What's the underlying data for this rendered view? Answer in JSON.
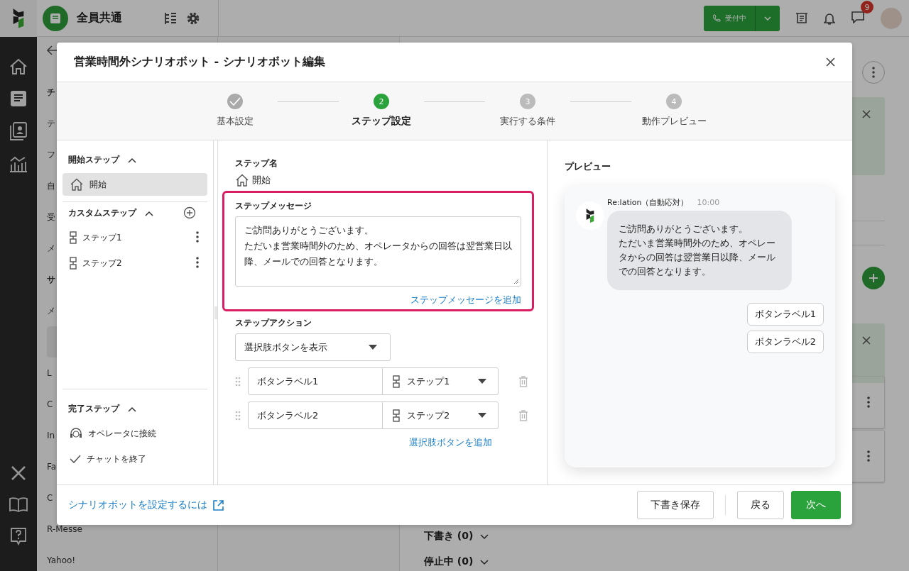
{
  "app_bar": {
    "workspace": "全員共通",
    "status_button": "受付中",
    "chat_badge": "9"
  },
  "background": {
    "list": [
      {
        "kind": "header",
        "label": "チ"
      },
      {
        "kind": "item",
        "label": "テ",
        "selected": false
      },
      {
        "kind": "item",
        "label": "フ",
        "selected": false
      },
      {
        "kind": "item",
        "label": "自",
        "selected": false
      },
      {
        "kind": "item",
        "label": "受",
        "selected": false
      },
      {
        "kind": "item",
        "label": "メ",
        "selected": false
      },
      {
        "kind": "header",
        "label": "サ"
      },
      {
        "kind": "item",
        "label": "メ",
        "selected": false
      },
      {
        "kind": "item",
        "selected": true
      },
      {
        "kind": "item",
        "label": "L",
        "selected": false
      },
      {
        "kind": "item",
        "label": "C",
        "selected": false
      },
      {
        "kind": "item",
        "label": "In",
        "selected": false
      },
      {
        "kind": "item",
        "label": "Fa",
        "selected": false
      },
      {
        "kind": "item",
        "label": "C",
        "selected": false
      },
      {
        "kind": "item",
        "label": "R-Messe",
        "selected": false
      },
      {
        "kind": "item",
        "label": "Yahoo!",
        "selected": false
      }
    ],
    "sections": [
      {
        "label": "下書き (0)",
        "expanded": false
      },
      {
        "label": "停止中 (0)",
        "expanded": false
      }
    ]
  },
  "dialog": {
    "title": "営業時間外シナリオボット - シナリオボット編集",
    "steps": [
      {
        "label": "基本設定",
        "done": true,
        "selected": false
      },
      {
        "number": "2",
        "label": "ステップ設定",
        "done": false,
        "selected": true
      },
      {
        "number": "3",
        "label": "実行する条件",
        "done": false,
        "selected": false
      },
      {
        "number": "4",
        "label": "動作プレビュー",
        "done": false,
        "selected": false
      }
    ],
    "step_tree": [
      {
        "title": "開始ステップ",
        "expanded": true,
        "can_add": false,
        "items": [
          {
            "label": "開始",
            "kind": "start",
            "selected": true,
            "menu": false
          }
        ]
      },
      {
        "title": "カスタムステップ",
        "expanded": true,
        "can_add": true,
        "items": [
          {
            "label": "ステップ1",
            "kind": "custom",
            "selected": false,
            "menu": true
          },
          {
            "label": "ステップ2",
            "kind": "custom",
            "selected": false,
            "menu": true
          }
        ]
      },
      {
        "title": "完了ステップ",
        "expanded": true,
        "can_add": false,
        "items": [
          {
            "label": "オペレータに接続",
            "kind": "operator",
            "selected": false,
            "menu": false
          },
          {
            "label": "チャットを終了",
            "kind": "end",
            "selected": false,
            "menu": false
          }
        ]
      }
    ],
    "editor": {
      "step_name_label": "ステップ名",
      "step_name": "開始",
      "message_label": "ステップメッセージ",
      "message": [
        "ご訪問ありがとうございます。",
        "ただいま営業時間外のため、オペレータからの回答は翌営業日以降、メールでの回答となります。"
      ],
      "add_message_link": "ステップメッセージを追加",
      "highlighted": true,
      "action_label": "ステップアクション",
      "action_select": "選択肢ボタンを表示",
      "choices": [
        {
          "label": "ボタンラベル1",
          "target": "ステップ1"
        },
        {
          "label": "ボタンラベル2",
          "target": "ステップ2"
        }
      ],
      "add_choice_link": "選択肢ボタンを追加"
    },
    "preview": {
      "title": "プレビュー",
      "sender": "Re:lation（自動応対）",
      "time": "10:00",
      "message": [
        "ご訪問ありがとうございます。",
        "ただいま営業時間外のため、オペレータからの回答は翌営業日以降、メールでの回答となります。"
      ],
      "buttons": [
        "ボタンラベル1",
        "ボタンラベル2"
      ]
    },
    "footer": {
      "help_link": "シナリオボットを設定するには",
      "buttons": [
        {
          "label": "下書き保存",
          "kind": "secondary"
        },
        {
          "label": "戻る",
          "kind": "secondary"
        },
        {
          "label": "次へ",
          "kind": "primary"
        }
      ]
    }
  }
}
